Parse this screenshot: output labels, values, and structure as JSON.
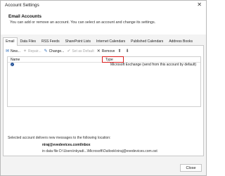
{
  "window": {
    "title": "Account Settings",
    "close_glyph": "✕"
  },
  "header": {
    "title": "Email Accounts",
    "subtitle": "You can add or remove an account. You can select an account and change its settings."
  },
  "tabs": [
    {
      "label": "Email",
      "active": true
    },
    {
      "label": "Data Files",
      "active": false
    },
    {
      "label": "RSS Feeds",
      "active": false
    },
    {
      "label": "SharePoint Lists",
      "active": false
    },
    {
      "label": "Internet Calendars",
      "active": false
    },
    {
      "label": "Published Calendars",
      "active": false
    },
    {
      "label": "Address Books",
      "active": false
    }
  ],
  "toolbar": {
    "new": {
      "label": "New...",
      "icon": "new-account-icon",
      "glyph": "✉",
      "enabled": true
    },
    "repair": {
      "label": "Repair...",
      "icon": "repair-icon",
      "glyph": "✦",
      "enabled": false
    },
    "change": {
      "label": "Change...",
      "icon": "change-icon",
      "glyph": "✎",
      "enabled": true
    },
    "set_default": {
      "label": "Set as Default",
      "icon": "set-default-icon",
      "glyph": "✔",
      "enabled": false
    },
    "remove": {
      "label": "Remove",
      "icon": "remove-icon",
      "glyph": "✕",
      "enabled": true
    },
    "move_up": {
      "icon": "arrow-up-icon",
      "glyph": "⬆"
    },
    "move_down": {
      "icon": "arrow-down-icon",
      "glyph": "⬇"
    }
  },
  "accounts_table": {
    "columns": [
      "Name",
      "Type"
    ],
    "rows": [
      {
        "name": "",
        "type": "Microsoft Exchange (send from this account by default)",
        "default": true
      }
    ]
  },
  "delivery": {
    "label": "Selected account delivers new messages to the following location:",
    "folder": "niraj@evedevices.com\\Inbox",
    "data_file": "in data file D:\\Users\\nkyadi...\\Microsoft\\Outlook\\niraj@evedevices.com.ost"
  },
  "footer": {
    "close_label": "Close"
  },
  "colors": {
    "highlight_border": "#d91d1d",
    "default_badge": "#1f4f96"
  }
}
